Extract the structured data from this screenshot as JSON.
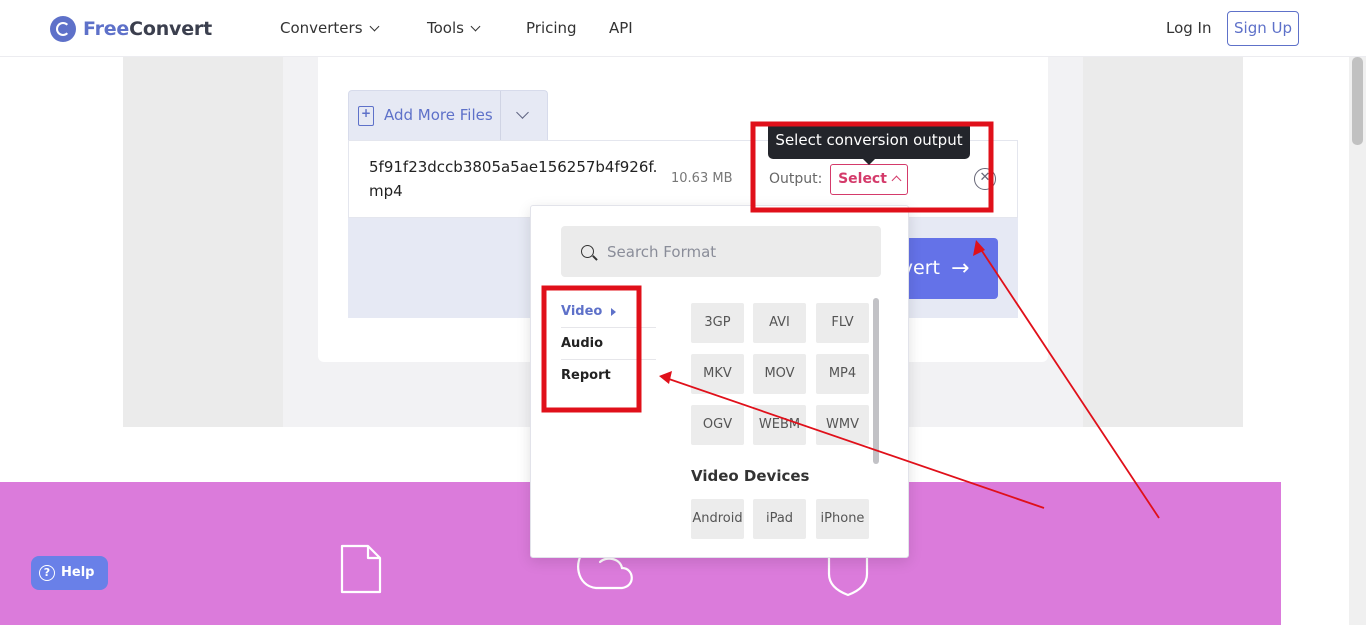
{
  "header": {
    "logo_free": "Free",
    "logo_convert": "Convert",
    "nav": [
      {
        "label": "Converters",
        "has_dropdown": true
      },
      {
        "label": "Tools",
        "has_dropdown": true
      },
      {
        "label": "Pricing",
        "has_dropdown": false
      },
      {
        "label": "API",
        "has_dropdown": false
      }
    ],
    "login": "Log In",
    "signup": "Sign Up"
  },
  "upload": {
    "add_more_label": "Add More Files",
    "file": {
      "name": "5f91f23dccb3805a5ae156257b4f926f.mp4",
      "size": "10.63 MB",
      "output_label": "Output:",
      "select_label": "Select"
    },
    "convert_label": "Convert"
  },
  "tooltip": "Select conversion output",
  "dropdown": {
    "search_placeholder": "Search Format",
    "categories": [
      "Video",
      "Audio",
      "Report"
    ],
    "active_category": "Video",
    "formats": [
      "3GP",
      "AVI",
      "FLV",
      "MKV",
      "MOV",
      "MP4",
      "OGV",
      "WEBM",
      "WMV"
    ],
    "devices_title": "Video Devices",
    "devices": [
      "Android",
      "iPad",
      "iPhone"
    ]
  },
  "help_label": "Help",
  "colors": {
    "brand": "#5e71c9",
    "select_accent": "#d43a6a",
    "banner": "#db7bdb",
    "annotation": "#e0101a"
  }
}
